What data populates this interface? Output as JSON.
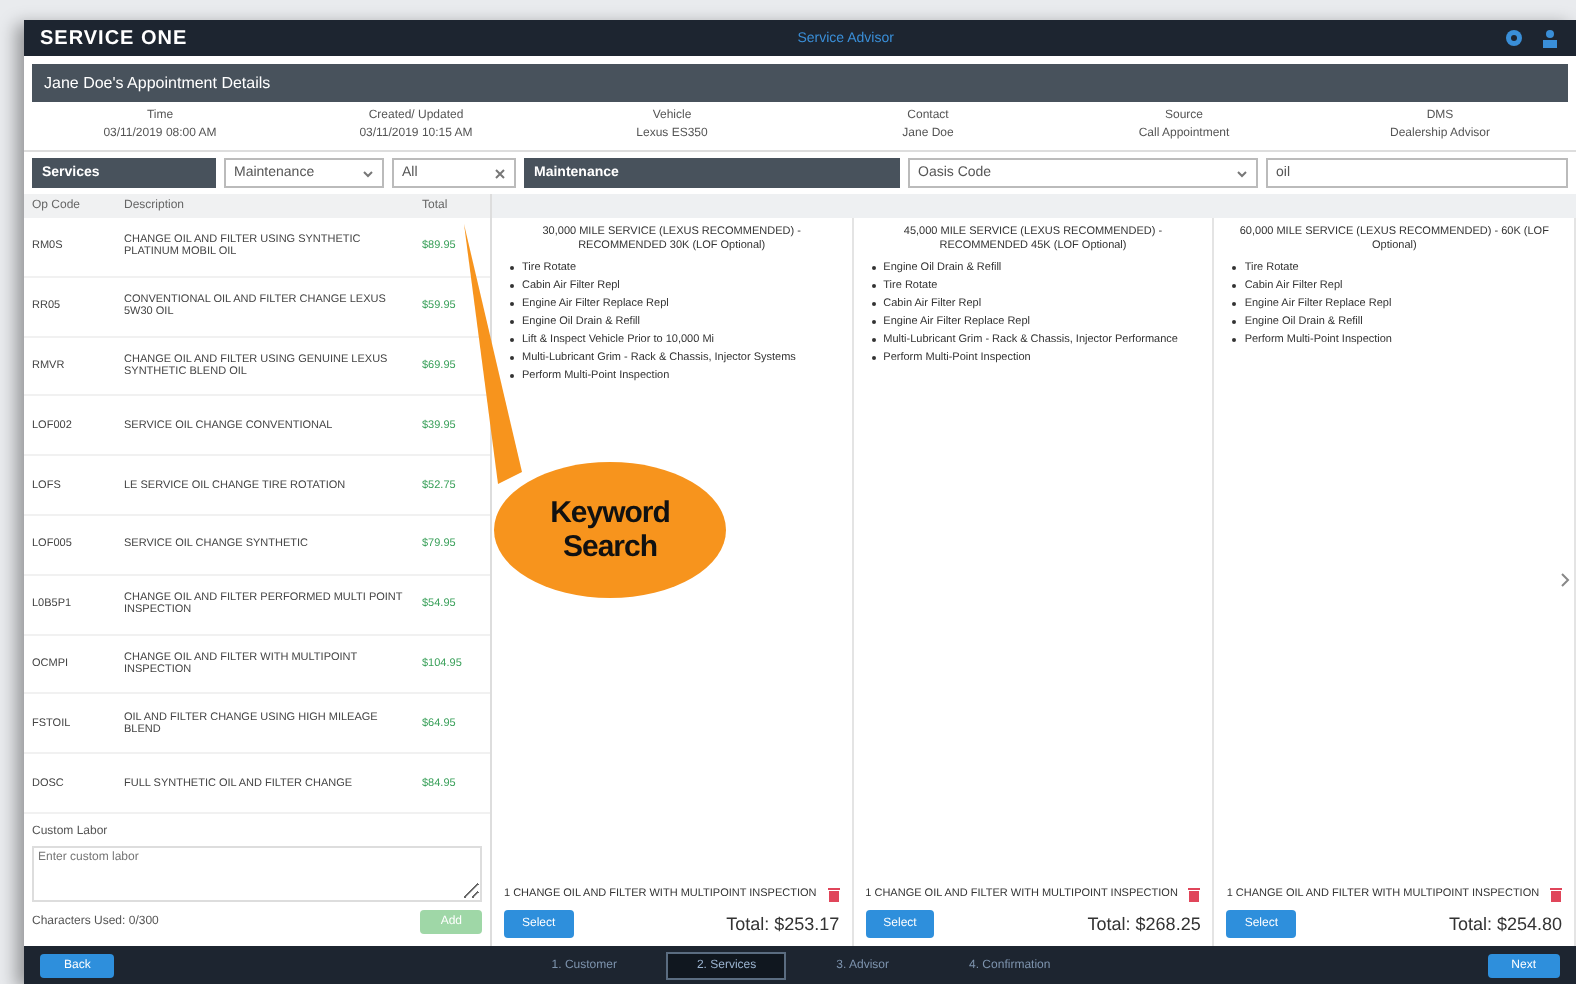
{
  "topbar": {
    "logo": "SERVICE ONE",
    "title": "Service Advisor"
  },
  "appointment": {
    "title": "Jane Doe's Appointment Details",
    "fields": [
      {
        "label": "Time",
        "value": "03/11/2019 08:00 AM"
      },
      {
        "label": "Created/ Updated",
        "value": "03/11/2019 10:15 AM"
      },
      {
        "label": "Vehicle",
        "value": "Lexus ES350"
      },
      {
        "label": "Contact",
        "value": "Jane Doe"
      },
      {
        "label": "Source",
        "value": "Call Appointment"
      },
      {
        "label": "DMS",
        "value": "Dealership Advisor"
      }
    ]
  },
  "services": {
    "label": "Services",
    "filter": "Maintenance",
    "category": "All",
    "columns": [
      "Op Code",
      "Description",
      "Total"
    ],
    "rows": [
      {
        "code": "RM0S",
        "description": "CHANGE OIL AND FILTER USING SYNTHETIC PLATINUM MOBIL OIL",
        "total": "$89.95"
      },
      {
        "code": "RR05",
        "description": "CONVENTIONAL OIL AND FILTER CHANGE LEXUS 5W30 OIL",
        "total": "$59.95"
      },
      {
        "code": "RMVR",
        "description": "CHANGE OIL AND FILTER USING GENUINE LEXUS SYNTHETIC BLEND OIL",
        "total": "$69.95"
      },
      {
        "code": "LOF002",
        "description": "SERVICE OIL CHANGE CONVENTIONAL",
        "total": "$39.95"
      },
      {
        "code": "LOFS",
        "description": "LE SERVICE OIL CHANGE TIRE ROTATION",
        "total": "$52.75"
      },
      {
        "code": "LOF005",
        "description": "SERVICE OIL CHANGE SYNTHETIC",
        "total": "$79.95"
      },
      {
        "code": "L0B5P1",
        "description": "CHANGE OIL AND FILTER PERFORMED MULTI POINT INSPECTION",
        "total": "$54.95"
      },
      {
        "code": "OCMPI",
        "description": "CHANGE OIL AND FILTER WITH MULTIPOINT INSPECTION",
        "total": "$104.95"
      },
      {
        "code": "FSTOIL",
        "description": "OIL AND FILTER CHANGE USING HIGH MILEAGE BLEND",
        "total": "$64.95"
      },
      {
        "code": "DOSC",
        "description": "FULL SYNTHETIC OIL AND FILTER CHANGE",
        "total": "$84.95"
      }
    ],
    "custom_label": "Custom Labor",
    "custom_placeholder": "Enter custom labor",
    "chars": "Characters Used: 0/300",
    "add": "Add"
  },
  "maintenance": {
    "label": "Maintenance",
    "sort": "Oasis Code",
    "search": "oil",
    "packages": [
      {
        "title": "30,000 MILE SERVICE (LEXUS RECOMMENDED) - RECOMMENDED 30K (LOF Optional)",
        "items": [
          "Tire Rotate",
          "Cabin Air Filter Repl",
          "Engine Air Filter Replace Repl",
          "Engine Oil Drain & Refill",
          "Lift & Inspect Vehicle Prior to 10,000 Mi",
          "Multi-Lubricant Grim - Rack & Chassis, Injector Systems",
          "Perform Multi-Point Inspection"
        ],
        "line": "1 CHANGE OIL AND FILTER WITH MULTIPOINT INSPECTION",
        "select": "Select",
        "total": "Total: $253.17"
      },
      {
        "title": "45,000 MILE SERVICE (LEXUS RECOMMENDED) - RECOMMENDED 45K (LOF Optional)",
        "items": [
          "Engine Oil Drain & Refill",
          "Tire Rotate",
          "Cabin Air Filter Repl",
          "Engine Air Filter Replace Repl",
          "Multi-Lubricant Grim - Rack & Chassis, Injector Performance",
          "Perform Multi-Point Inspection"
        ],
        "line": "1 CHANGE OIL AND FILTER WITH MULTIPOINT INSPECTION",
        "select": "Select",
        "total": "Total: $268.25"
      },
      {
        "title": "60,000 MILE SERVICE (LEXUS RECOMMENDED) - 60K (LOF Optional)",
        "items": [
          "Tire Rotate",
          "Cabin Air Filter Repl",
          "Engine Air Filter Replace Repl",
          "Engine Oil Drain & Refill",
          "Perform Multi-Point Inspection"
        ],
        "line": "1 CHANGE OIL AND FILTER WITH MULTIPOINT INSPECTION",
        "select": "Select",
        "total": "Total: $254.80"
      }
    ]
  },
  "callout": "Keyword Search",
  "footer": {
    "back": "Back",
    "next": "Next",
    "steps": [
      {
        "label": "1. Customer",
        "selected": false
      },
      {
        "label": "2. Services",
        "selected": true
      },
      {
        "label": "3. Advisor",
        "selected": false
      },
      {
        "label": "4. Confirmation",
        "selected": false
      }
    ]
  }
}
